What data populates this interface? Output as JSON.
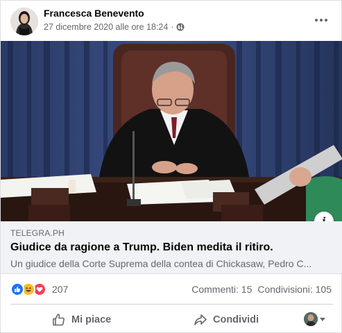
{
  "post": {
    "author": "Francesca Benevento",
    "timestamp": "27 dicembre 2020 alle ore 18:24",
    "separator": "·",
    "privacy_icon": "globe-icon",
    "more_icon": "more-options-icon"
  },
  "link_preview": {
    "domain": "TELEGRA.PH",
    "title": "Giudice da ragione a Trump. Biden medita il ritiro.",
    "description": "Un giudice della Corte Suprema della contea di Chickasaw, Pedro C...",
    "info_label": "i"
  },
  "engagement": {
    "reaction_icons": [
      "like-reaction-icon",
      "haha-reaction-icon",
      "love-reaction-icon"
    ],
    "reaction_count": "207",
    "comments": "Commenti: 15",
    "shares": "Condivisioni: 105"
  },
  "actions": {
    "like_label": "Mi piace",
    "share_label": "Condividi"
  },
  "colors": {
    "brand_blue": "#1877f2",
    "haha_yellow": "#f7b928",
    "love_red": "#f33e58",
    "secondary_text": "#65676b"
  }
}
